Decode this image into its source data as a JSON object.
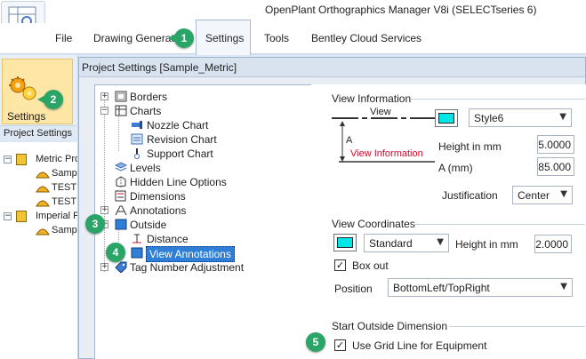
{
  "window": {
    "title": "OpenPlant Orthographics Manager V8i (SELECTseries 6)"
  },
  "ribbon": {
    "tabs": [
      "File",
      "Drawing Generation",
      "Settings",
      "Tools",
      "Bentley Cloud Services"
    ],
    "settings_button_label": "Settings",
    "group_label": "Project Settings"
  },
  "project_tree": {
    "items": [
      "Metric Proj",
      "Sampl",
      "TEST",
      "TEST",
      "Imperial Pro",
      "Sampl"
    ]
  },
  "dialog": {
    "title": "Project Settings [Sample_Metric]",
    "tree": {
      "borders": "Borders",
      "charts": "Charts",
      "nozzle_chart": "Nozzle Chart",
      "revision_chart": "Revision Chart",
      "support_chart": "Support Chart",
      "levels": "Levels",
      "hidden_line_options": "Hidden Line Options",
      "dimensions": "Dimensions",
      "annotations": "Annotations",
      "outside": "Outside",
      "distance": "Distance",
      "view_annotations": "View Annotations",
      "tag_number_adjustment": "Tag Number Adjustment"
    },
    "view_information": {
      "title": "View Information",
      "preview_view_label": "View",
      "preview_a_label": "A",
      "preview_view_info_label": "View Information",
      "style_value": "Style6",
      "height_label": "Height in mm",
      "height_value": "5.0000",
      "a_label": "A (mm)",
      "a_value": "85.000",
      "justification_label": "Justification",
      "justification_value": "Center"
    },
    "view_coordinates": {
      "title": "View Coordinates",
      "style_value": "Standard",
      "height_label": "Height in mm",
      "height_value": "2.0000",
      "box_out_label": "Box out",
      "position_label": "Position",
      "position_value": "BottomLeft/TopRight"
    },
    "start_outside_dimension": {
      "title": "Start Outside Dimension",
      "grid_line_label": "Use Grid Line for Equipment"
    }
  },
  "callouts": [
    "1",
    "2",
    "3",
    "4",
    "5"
  ],
  "colors": {
    "swatch_cyan": "#00e5e5",
    "callout_green": "#2aa567",
    "selection_blue": "#2f7fd6",
    "preview_red": "#c8102e"
  },
  "icons": [
    "expand-icon",
    "border-icon",
    "chart-icon",
    "nozzle-chart-icon",
    "revision-chart-icon",
    "support-chart-icon",
    "levels-icon",
    "hidden-line-icon",
    "dimension-icon",
    "annotation-icon",
    "outside-icon",
    "distance-icon",
    "view-annotation-icon",
    "tag-icon",
    "settings-gear-icon"
  ]
}
